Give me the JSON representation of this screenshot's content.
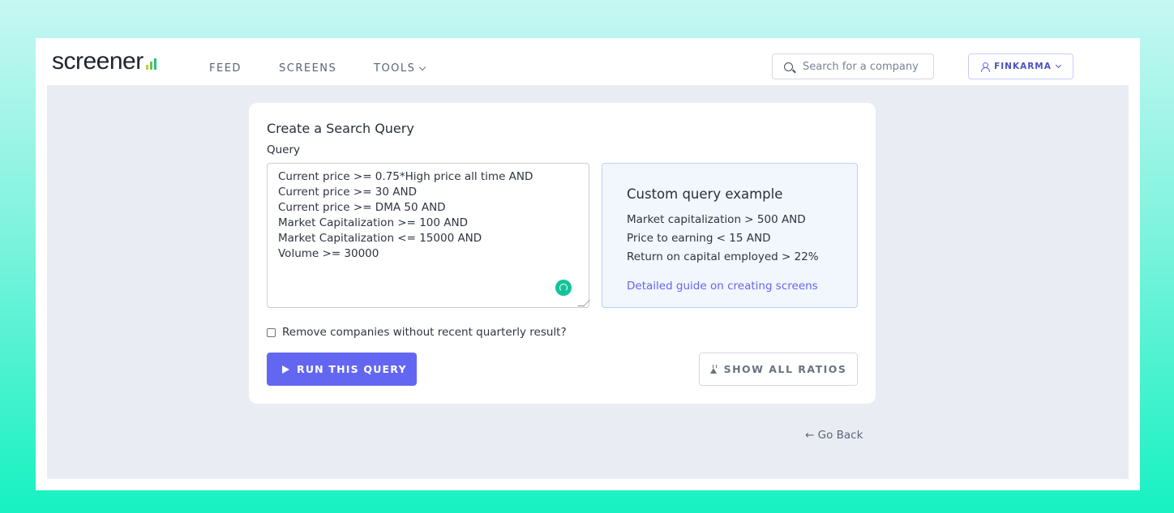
{
  "header": {
    "logo_text": "screener",
    "nav": {
      "feed": "FEED",
      "screens": "SCREENS",
      "tools": "TOOLS"
    },
    "search_placeholder": "Search for a company",
    "user_label": "FINKARMA"
  },
  "card": {
    "title": "Create a Search Query",
    "query_label": "Query",
    "query_value": "Current price >= 0.75*High price all time AND\nCurrent price >= 30 AND\nCurrent price >= DMA 50 AND\nMarket Capitalization >= 100 AND\nMarket Capitalization <= 15000 AND\nVolume >= 30000",
    "example": {
      "title": "Custom query example",
      "lines": [
        "Market capitalization > 500 AND",
        "Price to earning < 15 AND",
        "Return on capital employed > 22%"
      ],
      "link": "Detailed guide on creating screens"
    },
    "checkbox_label": "Remove companies without recent quarterly result?",
    "run_button": "RUN THIS QUERY",
    "ratios_button": "SHOW ALL RATIOS"
  },
  "go_back": "← Go Back",
  "colors": {
    "accent": "#6366f1",
    "logo_green": "#26c281",
    "background": "#e9edf3"
  }
}
